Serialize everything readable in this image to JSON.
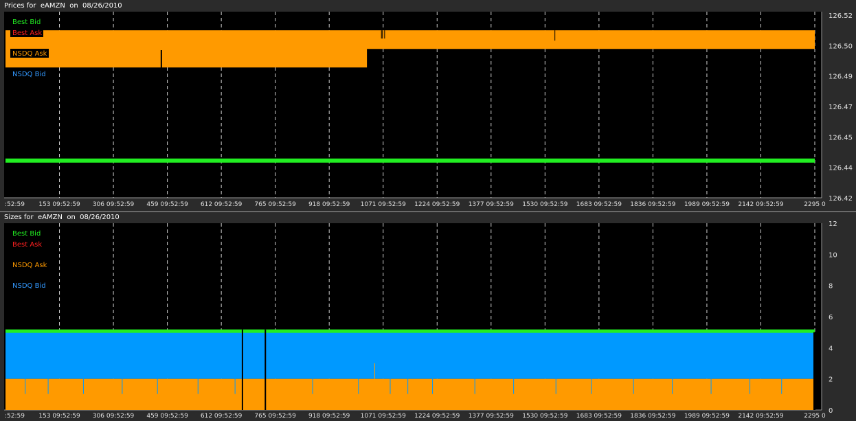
{
  "chart_data": [
    {
      "type": "line",
      "title": "Prices for  eAMZN  on  08/26/2010",
      "x_tick_labels": [
        ":52:59",
        "153 09:52:59",
        "306 09:52:59",
        "459 09:52:59",
        "612 09:52:59",
        "765 09:52:59",
        "918 09:52:59",
        "1071 09:52:59",
        "1224 09:52:59",
        "1377 09:52:59",
        "1530 09:52:59",
        "1683 09:52:59",
        "1836 09:52:59",
        "1989 09:52:59",
        "2142 09:52:59",
        "2295 0"
      ],
      "x_ticks": [
        0,
        153,
        306,
        459,
        612,
        765,
        918,
        1071,
        1224,
        1377,
        1530,
        1683,
        1836,
        1989,
        2142,
        2295
      ],
      "xlim": [
        0,
        2295
      ],
      "y_tick_labels": [
        "126.52",
        "126.50",
        "126.49",
        "126.47",
        "126.45",
        "126.44",
        "126.42"
      ],
      "ylim": [
        126.42,
        126.52
      ],
      "grid": true,
      "legend_position": "top-left",
      "legend": [
        {
          "name": "Best Bid",
          "color": "#22ee22"
        },
        {
          "name": "Best Ask",
          "color": "#ff2020"
        },
        {
          "name": "NSDQ Ask",
          "color": "#ff9a00"
        },
        {
          "name": "NSDQ Bid",
          "color": "#3399ff"
        }
      ],
      "series": [
        {
          "name": "Best Bid",
          "color": "#22ee22",
          "x": [
            0,
            2295
          ],
          "y": [
            126.44,
            126.44
          ]
        },
        {
          "name": "NSDQ Ask (high)",
          "color": "#ff9a00",
          "x": [
            0,
            1071,
            1071,
            2295
          ],
          "y": [
            126.51,
            126.51,
            126.51,
            126.51
          ]
        },
        {
          "name": "NSDQ Ask (low)",
          "color": "#ff9a00",
          "x": [
            0,
            1025,
            1025,
            2295
          ],
          "y": [
            126.49,
            126.49,
            126.5,
            126.5
          ]
        }
      ]
    },
    {
      "type": "area",
      "title": "Sizes for  eAMZN  on  08/26/2010",
      "x_tick_labels": [
        ":52:59",
        "153 09:52:59",
        "306 09:52:59",
        "459 09:52:59",
        "612 09:52:59",
        "765 09:52:59",
        "918 09:52:59",
        "1071 09:52:59",
        "1224 09:52:59",
        "1377 09:52:59",
        "1530 09:52:59",
        "1683 09:52:59",
        "1836 09:52:59",
        "1989 09:52:59",
        "2142 09:52:59",
        "2295 0"
      ],
      "x_ticks": [
        0,
        153,
        306,
        459,
        612,
        765,
        918,
        1071,
        1224,
        1377,
        1530,
        1683,
        1836,
        1989,
        2142,
        2295
      ],
      "xlim": [
        0,
        2295
      ],
      "y_tick_labels": [
        "12",
        "10",
        "8",
        "6",
        "4",
        "2",
        "0"
      ],
      "y_ticks": [
        12,
        10,
        8,
        6,
        4,
        2,
        0
      ],
      "ylim": [
        0,
        12
      ],
      "grid": true,
      "legend_position": "top-left",
      "legend": [
        {
          "name": "Best Bid",
          "color": "#22ee22"
        },
        {
          "name": "Best Ask",
          "color": "#ff2020"
        },
        {
          "name": "NSDQ Ask",
          "color": "#ff9a00"
        },
        {
          "name": "NSDQ Bid",
          "color": "#3399ff"
        }
      ],
      "series": [
        {
          "name": "Best Bid",
          "color": "#22ee22",
          "x": [
            0,
            2295
          ],
          "y": [
            5,
            5
          ]
        },
        {
          "name": "NSDQ Bid",
          "color": "#0099ff",
          "x": [
            0,
            2295
          ],
          "y": [
            5,
            5
          ]
        },
        {
          "name": "NSDQ Ask",
          "color": "#ff9a00",
          "x": [
            0,
            2295
          ],
          "y": [
            2,
            2
          ]
        }
      ]
    }
  ]
}
